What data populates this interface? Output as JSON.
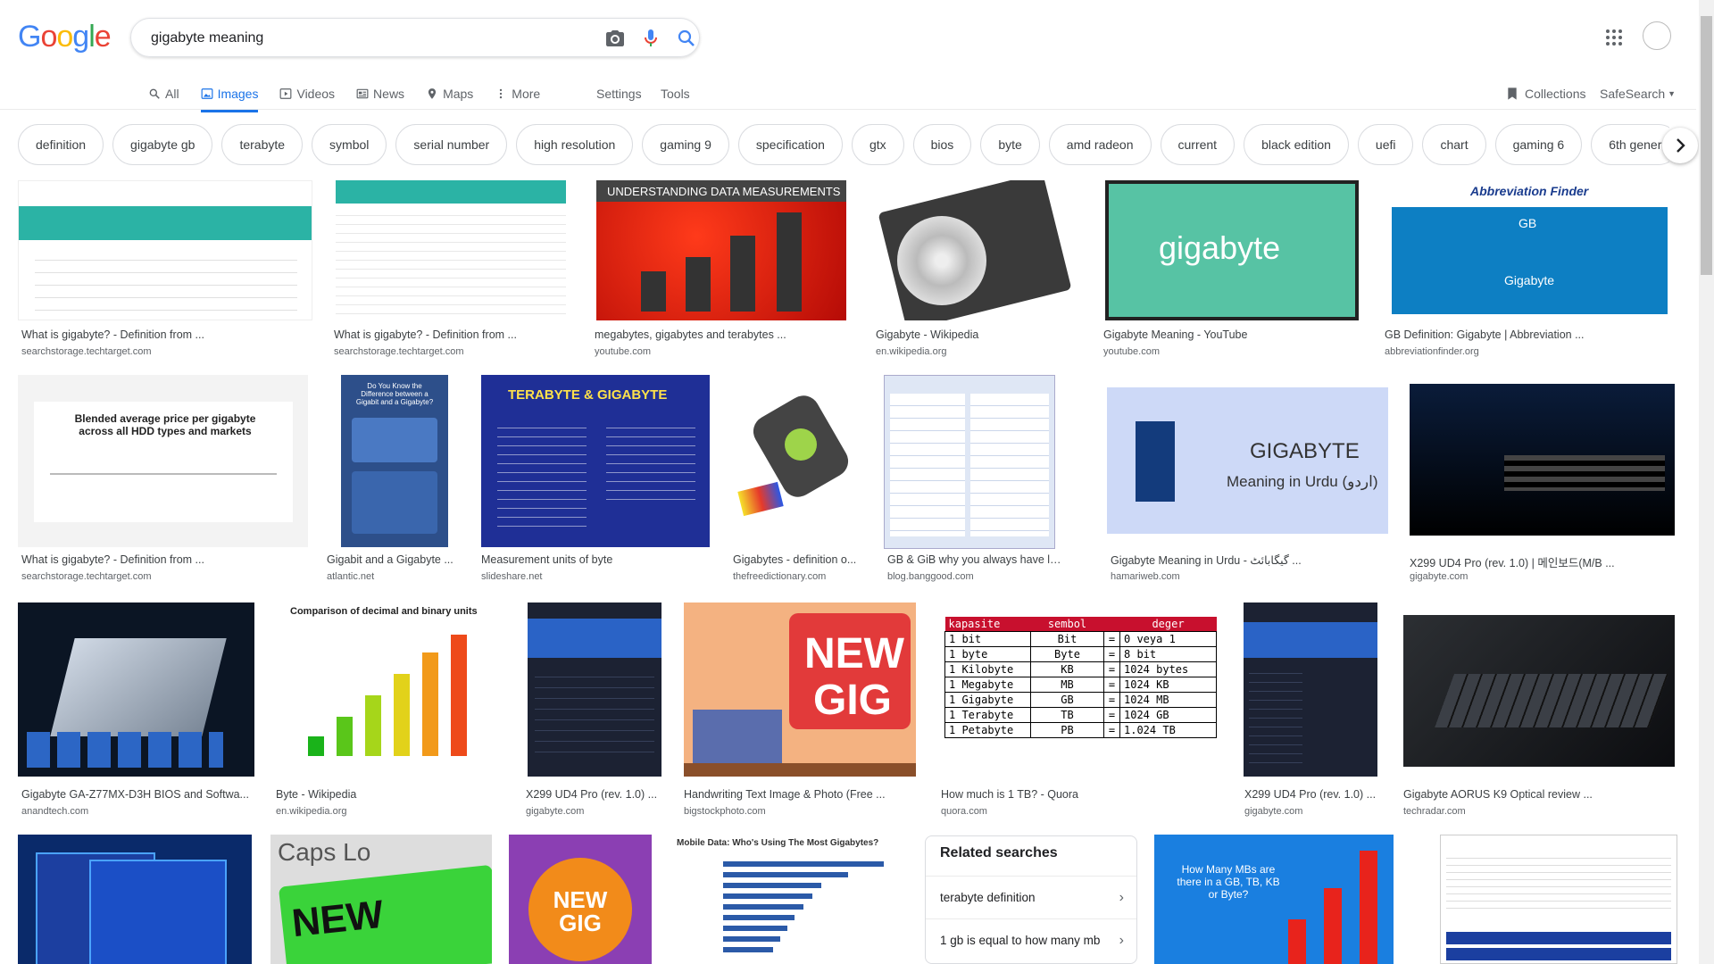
{
  "logo": "Google",
  "search": {
    "query": "gigabyte meaning"
  },
  "tabs": [
    {
      "label": "All",
      "icon": "search-icon",
      "active": false
    },
    {
      "label": "Images",
      "icon": "image-icon",
      "active": true
    },
    {
      "label": "Videos",
      "icon": "play-icon",
      "active": false
    },
    {
      "label": "News",
      "icon": "news-icon",
      "active": false
    },
    {
      "label": "Maps",
      "icon": "map-pin-icon",
      "active": false
    },
    {
      "label": "More",
      "icon": "more-vert-icon",
      "active": false
    }
  ],
  "settings_label": "Settings",
  "tools_label": "Tools",
  "collections_label": "Collections",
  "safesearch_label": "SafeSearch",
  "chips": [
    "definition",
    "gigabyte gb",
    "terabyte",
    "symbol",
    "serial number",
    "high resolution",
    "gaming 9",
    "specification",
    "gtx",
    "bios",
    "byte",
    "amd radeon",
    "current",
    "black edition",
    "uefi",
    "chart",
    "gaming 6",
    "6th gener"
  ],
  "results": [
    {
      "title": "What is gigabyte? - Definition from ...",
      "domain": "searchstorage.techtarget.com"
    },
    {
      "title": "What is gigabyte? - Definition from ...",
      "domain": "searchstorage.techtarget.com"
    },
    {
      "title": "megabytes, gigabytes and terabytes ...",
      "domain": "youtube.com"
    },
    {
      "title": "Gigabyte - Wikipedia",
      "domain": "en.wikipedia.org"
    },
    {
      "title": "Gigabyte Meaning - YouTube",
      "domain": "youtube.com"
    },
    {
      "title": "GB Definition: Gigabyte | Abbreviation ...",
      "domain": "abbreviationfinder.org"
    },
    {
      "title": "What is gigabyte? - Definition from ...",
      "domain": "searchstorage.techtarget.com"
    },
    {
      "title": "Gigabit and a Gigabyte ...",
      "domain": "atlantic.net"
    },
    {
      "title": "Measurement units of byte",
      "domain": "slideshare.net"
    },
    {
      "title": "Gigabytes - definition o...",
      "domain": "thefreedictionary.com"
    },
    {
      "title": "GB & GiB why you always have less ...",
      "domain": "blog.banggood.com"
    },
    {
      "title": "Gigabyte Meaning in Urdu - گیگابائٹ ...",
      "domain": "hamariweb.com"
    },
    {
      "title": "X299 UD4 Pro (rev. 1.0) | 메인보드(M/B ...",
      "domain": "gigabyte.com"
    },
    {
      "title": "Gigabyte GA-Z77MX-D3H BIOS and Softwa...",
      "domain": "anandtech.com"
    },
    {
      "title": "Byte - Wikipedia",
      "domain": "en.wikipedia.org"
    },
    {
      "title": "X299 UD4 Pro (rev. 1.0) ...",
      "domain": "gigabyte.com"
    },
    {
      "title": "Handwriting Text Image & Photo (Free ...",
      "domain": "bigstockphoto.com"
    },
    {
      "title": "How much is 1 TB? - Quora",
      "domain": "quora.com"
    },
    {
      "title": "X299 UD4 Pro (rev. 1.0) ...",
      "domain": "gigabyte.com"
    },
    {
      "title": "Gigabyte AORUS K9 Optical review ...",
      "domain": "techradar.com"
    }
  ],
  "thumb_text": {
    "r3_banner": "UNDERSTANDING DATA MEASUREMENTS",
    "r5_word": "gigabyte",
    "r6_brand": "Abbreviation Finder",
    "r6_gb": "GB",
    "r6_gigabyte": "Gigabyte",
    "r7_title": "Blended average price per gigabyte across all HDD types and markets",
    "r8_title": "Do You Know the Difference between a Gigabit and a Gigabyte?",
    "r9_title": "TERABYTE & GIGABYTE",
    "r12_title": "GIGABYTE",
    "r12_sub": "Meaning in Urdu (اردو)",
    "r14_title": "Comparison of decimal and binary units",
    "r17_new": "NEW",
    "r17_gig": "GIG",
    "r18_headers": [
      "kapasite",
      "sembol",
      "deger"
    ],
    "r18_rows": [
      [
        "1 bit",
        "Bit",
        "0 veya 1"
      ],
      [
        "1 byte",
        "Byte",
        "8 bit"
      ],
      [
        "1 Kilobyte",
        "KB",
        "1024 bytes"
      ],
      [
        "1 Megabyte",
        "MB",
        "1024 KB"
      ],
      [
        "1 Gigabyte",
        "GB",
        "1024 MB"
      ],
      [
        "1 Terabyte",
        "TB",
        "1024 GB"
      ],
      [
        "1 Petabyte",
        "PB",
        "1.024 TB"
      ]
    ],
    "r4_caps": "Caps Lo",
    "r4_new": "NEW",
    "r4_gig": "GIG",
    "r5_newgig": "NEW GIG",
    "r6_mobile": "Mobile Data: Who's Using The Most Gigabytes?",
    "r8_q": "How Many MBs are there in a GB, TB, KB or Byte?"
  },
  "related": {
    "title": "Related searches",
    "items": [
      "terabyte definition",
      "1 gb is equal to how many mb"
    ]
  }
}
